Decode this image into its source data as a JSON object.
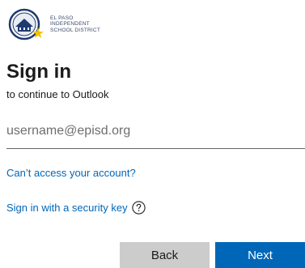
{
  "logo": {
    "line1": "EL PASO",
    "line2": "INDEPENDENT",
    "line3": "SCHOOL DISTRICT",
    "icon": "episd-seal-icon"
  },
  "header": {
    "title": "Sign in",
    "subtitle": "to continue to Outlook"
  },
  "form": {
    "username_placeholder": "username@episd.org",
    "username_value": ""
  },
  "links": {
    "cant_access": "Can’t access your account?",
    "security_key": "Sign in with a security key",
    "help_icon": "question-circle-icon"
  },
  "buttons": {
    "back": "Back",
    "next": "Next"
  },
  "colors": {
    "accent": "#0067b8",
    "back_button": "#cccccc",
    "text": "#1b1b1b",
    "logo_navy": "#1f3a6e",
    "logo_star": "#f2c200"
  }
}
